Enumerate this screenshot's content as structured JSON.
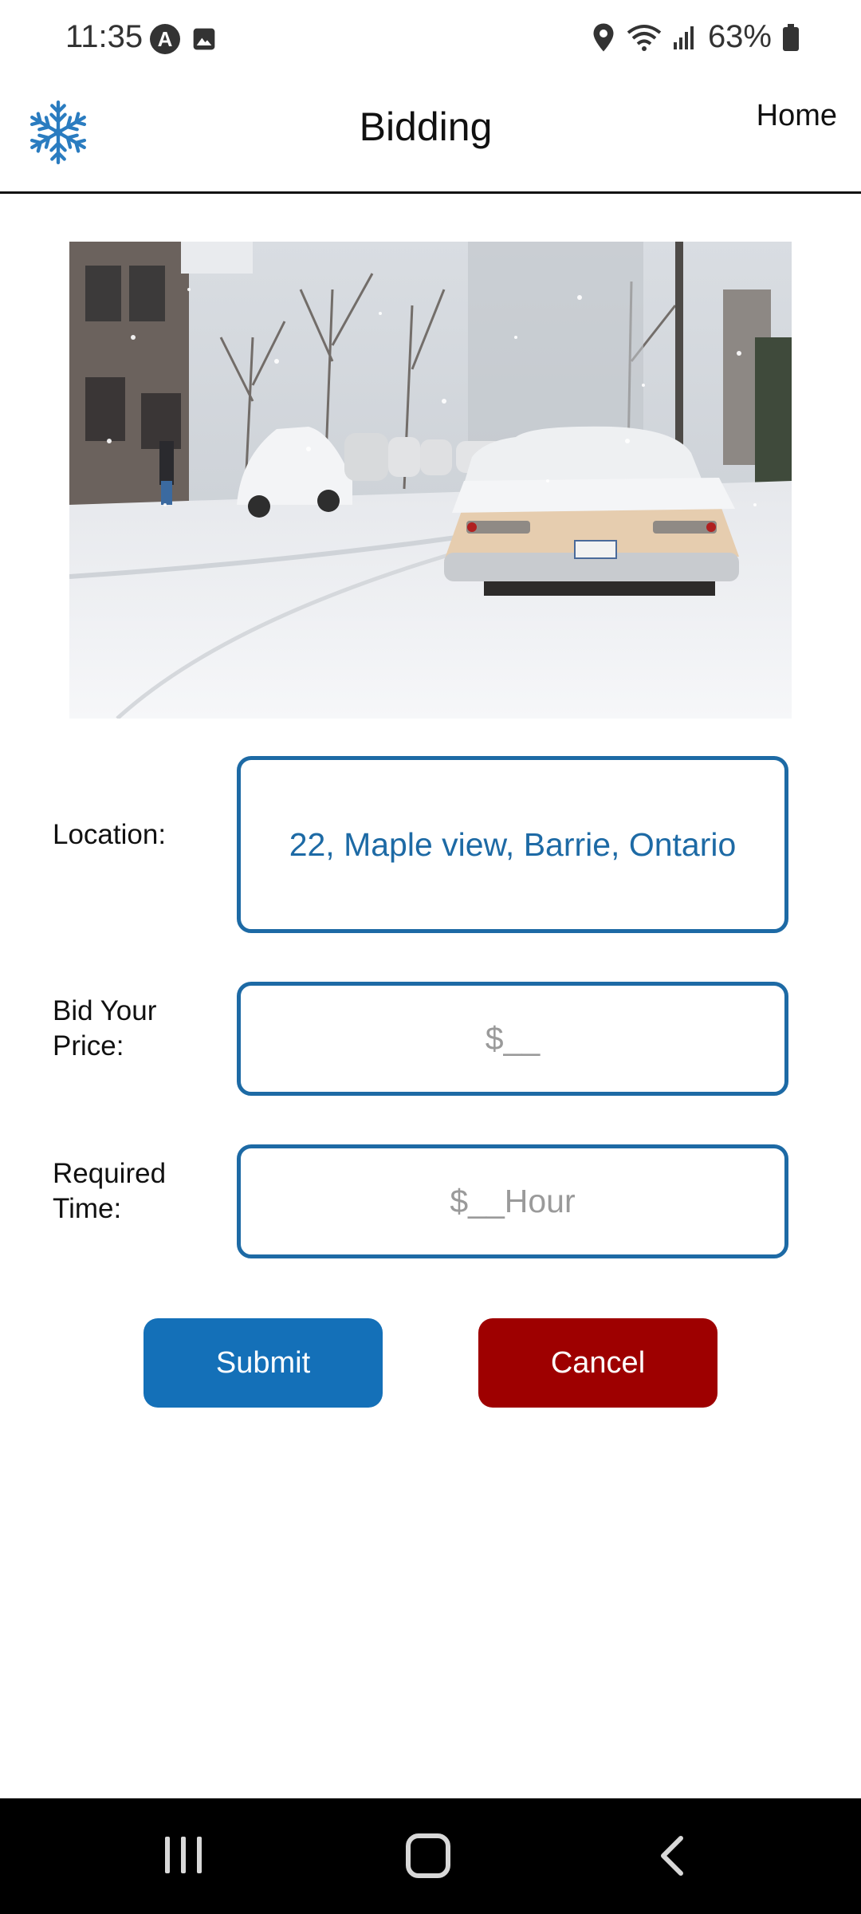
{
  "status_bar": {
    "time": "11:35",
    "battery": "63%",
    "icons": [
      "a-badge-icon",
      "image-icon",
      "location-icon",
      "wifi-icon",
      "signal-icon",
      "battery-icon"
    ]
  },
  "header": {
    "title": "Bidding",
    "home_link": "Home",
    "logo_icon": "snowflake-icon"
  },
  "hero": {
    "description_icon": "snowy-street-photo"
  },
  "form": {
    "location_label": "Location:",
    "location_value": "22, Maple view, Barrie, Ontario",
    "price_label_line1": "Bid Your",
    "price_label_line2": "Price:",
    "price_placeholder": "$__",
    "time_label_line1": "Required",
    "time_label_line2": "Time:",
    "time_placeholder": "$__Hour"
  },
  "actions": {
    "submit_label": "Submit",
    "cancel_label": "Cancel"
  },
  "colors": {
    "accent": "#1d6aa5",
    "submit": "#1470b8",
    "cancel": "#9e0000"
  }
}
